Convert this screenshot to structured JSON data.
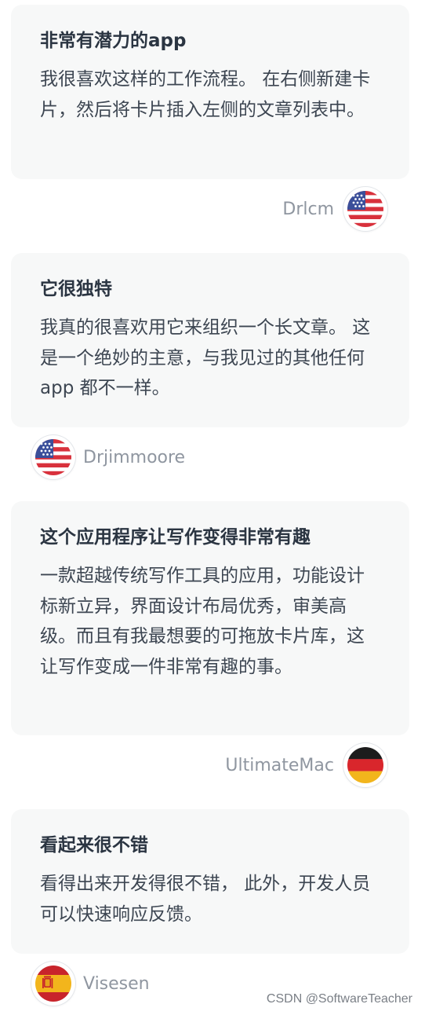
{
  "reviews": [
    {
      "title": "非常有潜力的app",
      "body": "我很喜欢这样的工作流程。 在右侧新建卡片，然后将卡片插入左侧的文章列表中。",
      "author": "Drlcm",
      "flag_icon": "usa-flag-icon"
    },
    {
      "title": "它很独特",
      "body": "我真的很喜欢用它来组织一个长文章。 这是一个绝妙的主意，与我见过的其他任何 app 都不一样。",
      "author": "Drjimmoore",
      "flag_icon": "usa-flag-icon"
    },
    {
      "title": "这个应用程序让写作变得非常有趣",
      "body": "一款超越传统写作工具的应用，功能设计标新立异，界面设计布局优秀，审美高级。而且有我最想要的可拖放卡片库，这让写作变成一件非常有趣的事。",
      "author": "UltimateMac",
      "flag_icon": "germany-flag-icon"
    },
    {
      "title": "看起来很不错",
      "body": "看得出来开发得很不错， 此外，开发人员可以快速响应反馈。",
      "author": "Visesen",
      "flag_icon": "spain-flag-icon"
    }
  ],
  "watermark": "CSDN @SoftwareTeacher",
  "colors": {
    "card_background": "#f7f8f8",
    "title_text": "#2b3542",
    "body_text": "#3d4652",
    "author_text": "#8f96a0"
  }
}
